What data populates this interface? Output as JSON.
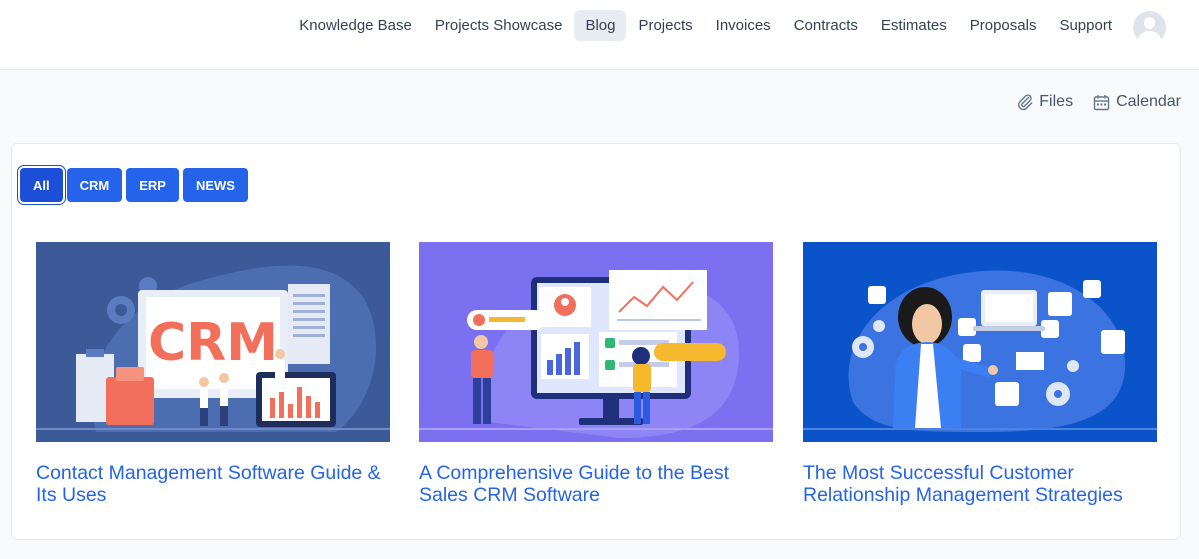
{
  "nav": {
    "items": [
      "Knowledge Base",
      "Projects Showcase",
      "Blog",
      "Projects",
      "Invoices",
      "Contracts",
      "Estimates",
      "Proposals",
      "Support"
    ],
    "active": "Blog"
  },
  "tools": {
    "files": "Files",
    "calendar": "Calendar"
  },
  "filters": [
    "All",
    "CRM",
    "ERP",
    "NEWS"
  ],
  "posts": [
    {
      "title": "Contact Management Software Guide & Its Uses",
      "image_text": "CRM"
    },
    {
      "title": "A Comprehensive Guide to the Best Sales CRM Software"
    },
    {
      "title": "The Most Successful Customer Relationship Management Strategies"
    }
  ],
  "colors": {
    "accent": "#2563eb",
    "accent_active": "#1d4ed8",
    "thumb1": "#3b5a97",
    "thumb2": "#7b70f0",
    "thumb3": "#0a53c9"
  }
}
